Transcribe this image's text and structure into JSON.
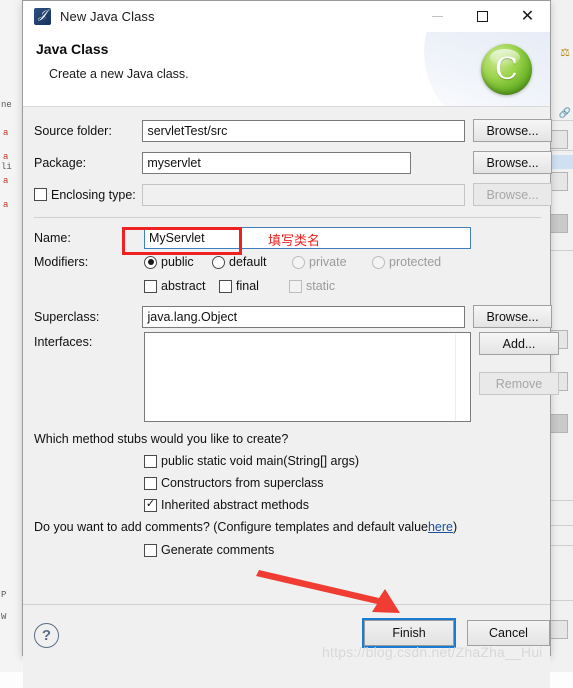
{
  "window": {
    "title": "New Java Class",
    "icon": "java-class-icon",
    "controls": {
      "minimize": "minimize-icon",
      "maximize": "maximize-icon",
      "close": "close-icon"
    }
  },
  "header": {
    "title": "Java Class",
    "subtitle": "Create a new Java class.",
    "logo": "green-c-logo"
  },
  "form": {
    "source_folder": {
      "label": "Source folder:",
      "value": "servletTest/src",
      "browse": "Browse..."
    },
    "package": {
      "label": "Package:",
      "value": "myservlet",
      "browse": "Browse..."
    },
    "enclosing_type": {
      "label": "Enclosing type:",
      "value": "",
      "checked": false,
      "browse": "Browse...",
      "disabled": true
    },
    "name": {
      "label": "Name:",
      "value": "MyServlet"
    },
    "modifiers": {
      "label": "Modifiers:",
      "radios": [
        {
          "label": "public",
          "selected": true,
          "disabled": false
        },
        {
          "label": "default",
          "selected": false,
          "disabled": false
        },
        {
          "label": "private",
          "selected": false,
          "disabled": true
        },
        {
          "label": "protected",
          "selected": false,
          "disabled": true
        }
      ],
      "checkboxes": [
        {
          "label": "abstract",
          "checked": false,
          "disabled": false
        },
        {
          "label": "final",
          "checked": false,
          "disabled": false
        },
        {
          "label": "static",
          "checked": false,
          "disabled": true
        }
      ]
    },
    "superclass": {
      "label": "Superclass:",
      "value": "java.lang.Object",
      "browse": "Browse..."
    },
    "interfaces": {
      "label": "Interfaces:",
      "items": [],
      "add": "Add...",
      "remove": "Remove"
    }
  },
  "stubs": {
    "question": "Which method stubs would you like to create?",
    "options": [
      {
        "label": "public static void main(String[] args)",
        "checked": false
      },
      {
        "label": "Constructors from superclass",
        "checked": false
      },
      {
        "label": "Inherited abstract methods",
        "checked": true
      }
    ]
  },
  "comments": {
    "question_prefix": "Do you want to add comments? (Configure templates and default value ",
    "link": "here",
    "question_suffix": ")",
    "option": {
      "label": "Generate comments",
      "checked": false
    }
  },
  "footer": {
    "help": "help-icon",
    "finish": "Finish",
    "cancel": "Cancel"
  },
  "annotations": {
    "name_note": "填写类名",
    "name_box_color": "#ee2222",
    "arrow_color": "#f03d33"
  },
  "watermark": "https://blog.csdn.net/ZhaZha__Hui"
}
